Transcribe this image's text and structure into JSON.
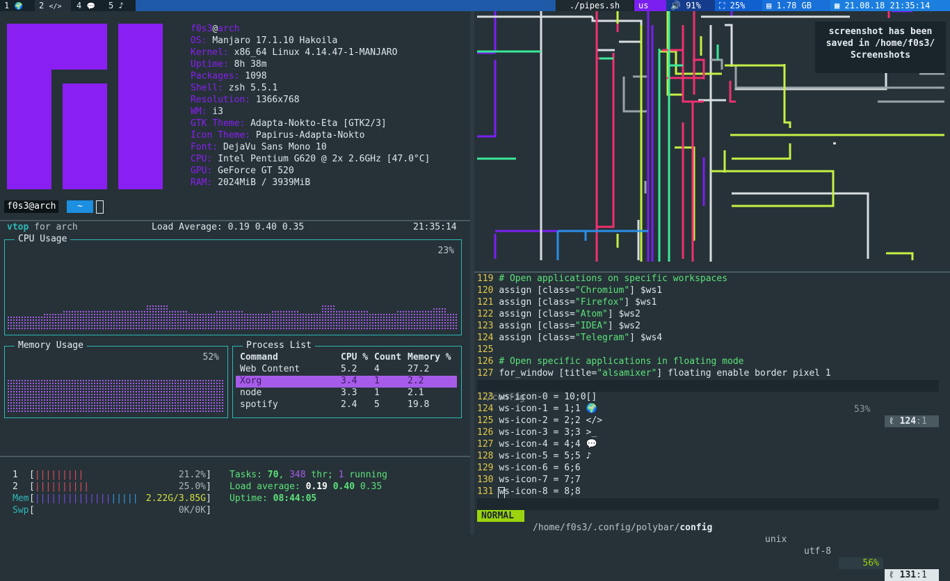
{
  "colors": {
    "accent": "#8a1ff3",
    "teal": "#2fb8b8",
    "green": "#5de27a",
    "yellow": "#e4c94a",
    "lime": "#c6f045"
  },
  "bar": {
    "workspaces": [
      {
        "num": "1",
        "icon": "🌍",
        "icon_name": "globe-icon"
      },
      {
        "num": "2",
        "icon": "</>",
        "icon_name": "code-icon"
      },
      {
        "num": "4",
        "icon": "💬",
        "icon_name": "chat-icon"
      },
      {
        "num": "5",
        "icon": "♪",
        "icon_name": "music-icon"
      }
    ],
    "window_title": "./pipes.sh",
    "layout": "us",
    "volume": "91%",
    "cpu": "25%",
    "memory": "1.78 GB",
    "datetime": "21.08.18 21:35:14"
  },
  "neofetch": {
    "user": "f0s3",
    "at": "@",
    "host": "arch",
    "lines": [
      {
        "key": "OS: ",
        "value": "Manjaro 17.1.10 Hakoila"
      },
      {
        "key": "Kernel: ",
        "value": "x86_64 Linux 4.14.47-1-MANJARO"
      },
      {
        "key": "Uptime: ",
        "value": "8h 38m"
      },
      {
        "key": "Packages: ",
        "value": "1098"
      },
      {
        "key": "Shell: ",
        "value": "zsh 5.5.1"
      },
      {
        "key": "Resolution: ",
        "value": "1366x768"
      },
      {
        "key": "WM: ",
        "value": "i3"
      },
      {
        "key": "GTK Theme: ",
        "value": "Adapta-Nokto-Eta [GTK2/3]"
      },
      {
        "key": "Icon Theme: ",
        "value": "Papirus-Adapta-Nokto"
      },
      {
        "key": "Font: ",
        "value": "DejaVu Sans Mono 10"
      },
      {
        "key": "CPU: ",
        "value": "Intel Pentium G620 @ 2x 2.6GHz [47.0°C]"
      },
      {
        "key": "GPU: ",
        "value": "GeForce GT 520"
      },
      {
        "key": "RAM: ",
        "value": "2024MiB / 3939MiB"
      }
    ],
    "prompt_user": "f0s3@arch",
    "prompt_dir": "~"
  },
  "vtop": {
    "app": "vtop",
    "for_text": " for arch",
    "load": "Load Average: 0.19 0.40 0.35",
    "time": "21:35:14",
    "cpu_title": "CPU Usage",
    "cpu_percent": "23%",
    "mem_title": "Memory Usage",
    "mem_percent": "52%",
    "proc_title": "Process List",
    "proc_headers": [
      "Command",
      "CPU %",
      "Count",
      "Memory %"
    ],
    "processes": [
      {
        "cmd": "Web Content",
        "cpu": "5.2",
        "count": "4",
        "mem": "27.2"
      },
      {
        "cmd": "Xorg",
        "cpu": "3.4",
        "count": "1",
        "mem": "2.2"
      },
      {
        "cmd": "node",
        "cpu": "3.3",
        "count": "1",
        "mem": "2.1"
      },
      {
        "cmd": "spotify",
        "cpu": "2.4",
        "count": "5",
        "mem": "19.8"
      }
    ]
  },
  "htop": {
    "cpu1_label": "1",
    "cpu1_value": "21.2%",
    "cpu2_label": "2",
    "cpu2_value": "25.0%",
    "mem_label": "Mem",
    "mem_value": "2.22G/3.85G",
    "swp_label": "Swp",
    "swp_value": "0K/0K",
    "tasks_label": "Tasks: ",
    "tasks_count": "70",
    "thr_count": "348",
    "thr_label": " thr; ",
    "running_count": "1",
    "running_label": " running",
    "load_label": "Load average: ",
    "load1": "0.19",
    "load5": "0.40",
    "load15": "0.35",
    "uptime_label": "Uptime: ",
    "uptime_value": "08:44:05"
  },
  "notification": {
    "line1": "screenshot has been",
    "line2": "saved in /home/f0s3/",
    "line3": "Screenshots"
  },
  "vim_top": {
    "lines": [
      {
        "n": "119",
        "type": "comment",
        "text": "# Open applications on specific workspaces"
      },
      {
        "n": "120",
        "type": "assign",
        "pre": "assign [class=",
        "str": "\"Chromium\"",
        "post": "] $ws1"
      },
      {
        "n": "121",
        "type": "assign",
        "pre": "assign [class=",
        "str": "\"Firefox\"",
        "post": "] $ws1"
      },
      {
        "n": "122",
        "type": "assign",
        "pre": "assign [class=",
        "str": "\"Atom\"",
        "post": "] $ws2"
      },
      {
        "n": "123",
        "type": "assign",
        "pre": "assign [class=",
        "str": "\"IDEA\"",
        "post": "] $ws2"
      },
      {
        "n": "124",
        "type": "assign",
        "pre": "assign [class=",
        "str": "\"Telegram\"",
        "post": "] $ws4"
      },
      {
        "n": "125",
        "type": "blank",
        "text": ""
      },
      {
        "n": "126",
        "type": "comment",
        "text": "# Open specific applications in floating mode"
      },
      {
        "n": "127",
        "type": "assign",
        "pre": "for_window [title=",
        "str": "\"alsamixer\"",
        "post": "] floating enable border pixel 1"
      }
    ],
    "status_file": "./config",
    "status_percent": "53%",
    "status_ln": "124",
    "status_col": "1"
  },
  "vim_bottom": {
    "lines": [
      {
        "n": "123",
        "text": "ws-icon-0 = 10;0[]"
      },
      {
        "n": "124",
        "text": "ws-icon-1 = 1;1 🌍"
      },
      {
        "n": "125",
        "text": "ws-icon-2 = 2;2 </>"
      },
      {
        "n": "126",
        "text": "ws-icon-3 = 3;3 >_"
      },
      {
        "n": "127",
        "text": "ws-icon-4 = 4;4 💬"
      },
      {
        "n": "128",
        "text": "ws-icon-5 = 5;5 ♪"
      },
      {
        "n": "129",
        "text": "ws-icon-6 = 6;6"
      },
      {
        "n": "130",
        "text": "ws-icon-7 = 7;7"
      },
      {
        "n": "131",
        "text": "ws-icon-8 = 8;8"
      }
    ],
    "mode": "NORMAL",
    "path_prefix": "/home/f0s3/.config/polybar/",
    "path_file": "config",
    "format": "unix",
    "encoding": "utf-8",
    "percent": "56%",
    "ln": "131",
    "col": "1"
  }
}
